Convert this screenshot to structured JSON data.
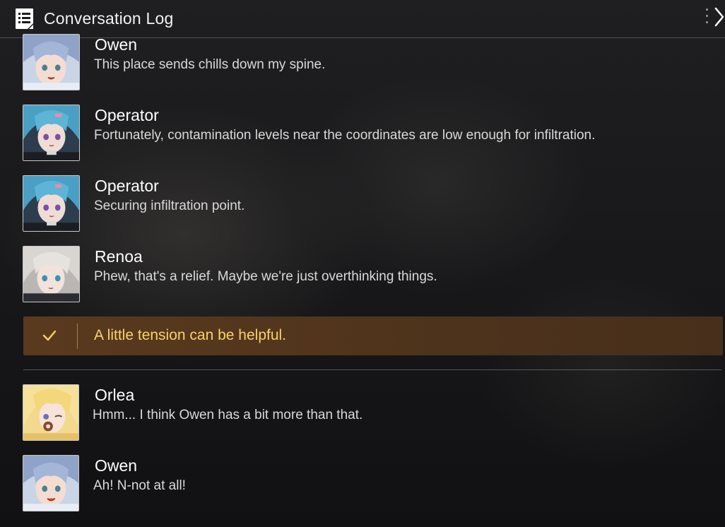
{
  "header": {
    "title": "Conversation Log",
    "icon": "log-document-icon",
    "close_icon": "chevron-right-icon"
  },
  "entries": [
    {
      "speaker": "Owen",
      "text": "This place sends chills down my spine.",
      "avatar": "owen-portrait"
    },
    {
      "speaker": "Operator",
      "text": "Fortunately, contamination levels near the coordinates are low enough for infiltration.",
      "avatar": "operator-portrait"
    },
    {
      "speaker": "Operator",
      "text": "Securing infiltration point.",
      "avatar": "operator-portrait"
    },
    {
      "speaker": "Renoa",
      "text": "Phew, that's a relief. Maybe we're just overthinking things.",
      "avatar": "renoa-portrait"
    }
  ],
  "choice": {
    "text": "A little tension can be helpful.",
    "icon": "checkmark-icon",
    "accent": "#f7d36a"
  },
  "entries_after": [
    {
      "speaker": "Orlea",
      "text": "Hmm... I think Owen has a bit more than that.",
      "avatar": "orlea-portrait"
    },
    {
      "speaker": "Owen",
      "text": "Ah! N-not at all!",
      "avatar": "owen-portrait"
    }
  ]
}
